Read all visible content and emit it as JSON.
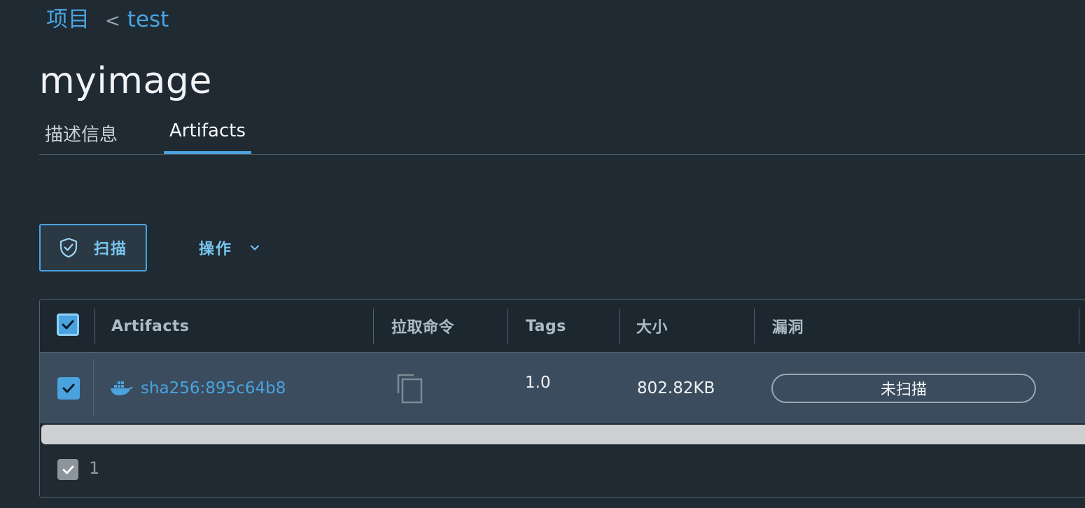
{
  "breadcrumb": {
    "project_link": "项目",
    "separator": "<",
    "current": "test"
  },
  "page_title": "myimage",
  "tabs": [
    {
      "label": "描述信息",
      "active": false
    },
    {
      "label": "Artifacts",
      "active": true
    }
  ],
  "toolbar": {
    "scan_label": "扫描",
    "scan_icon": "shield-check-icon",
    "actions_label": "操作",
    "actions_icon": "chevron-down-icon"
  },
  "table": {
    "columns": [
      "Artifacts",
      "拉取命令",
      "Tags",
      "大小",
      "漏洞"
    ],
    "rows": [
      {
        "selected": true,
        "type_icon": "docker-icon",
        "digest": "sha256:895c64b8",
        "pull_command_icon": "copy-icon",
        "tags": "1.0",
        "size": "802.82KB",
        "vulnerabilities": "未扫描"
      }
    ],
    "footer_selected_count": "1"
  },
  "colors": {
    "background": "#1f2a33",
    "accent": "#4aa3df",
    "selected_row": "#3a4c5e",
    "header_bg": "#1c2730"
  }
}
